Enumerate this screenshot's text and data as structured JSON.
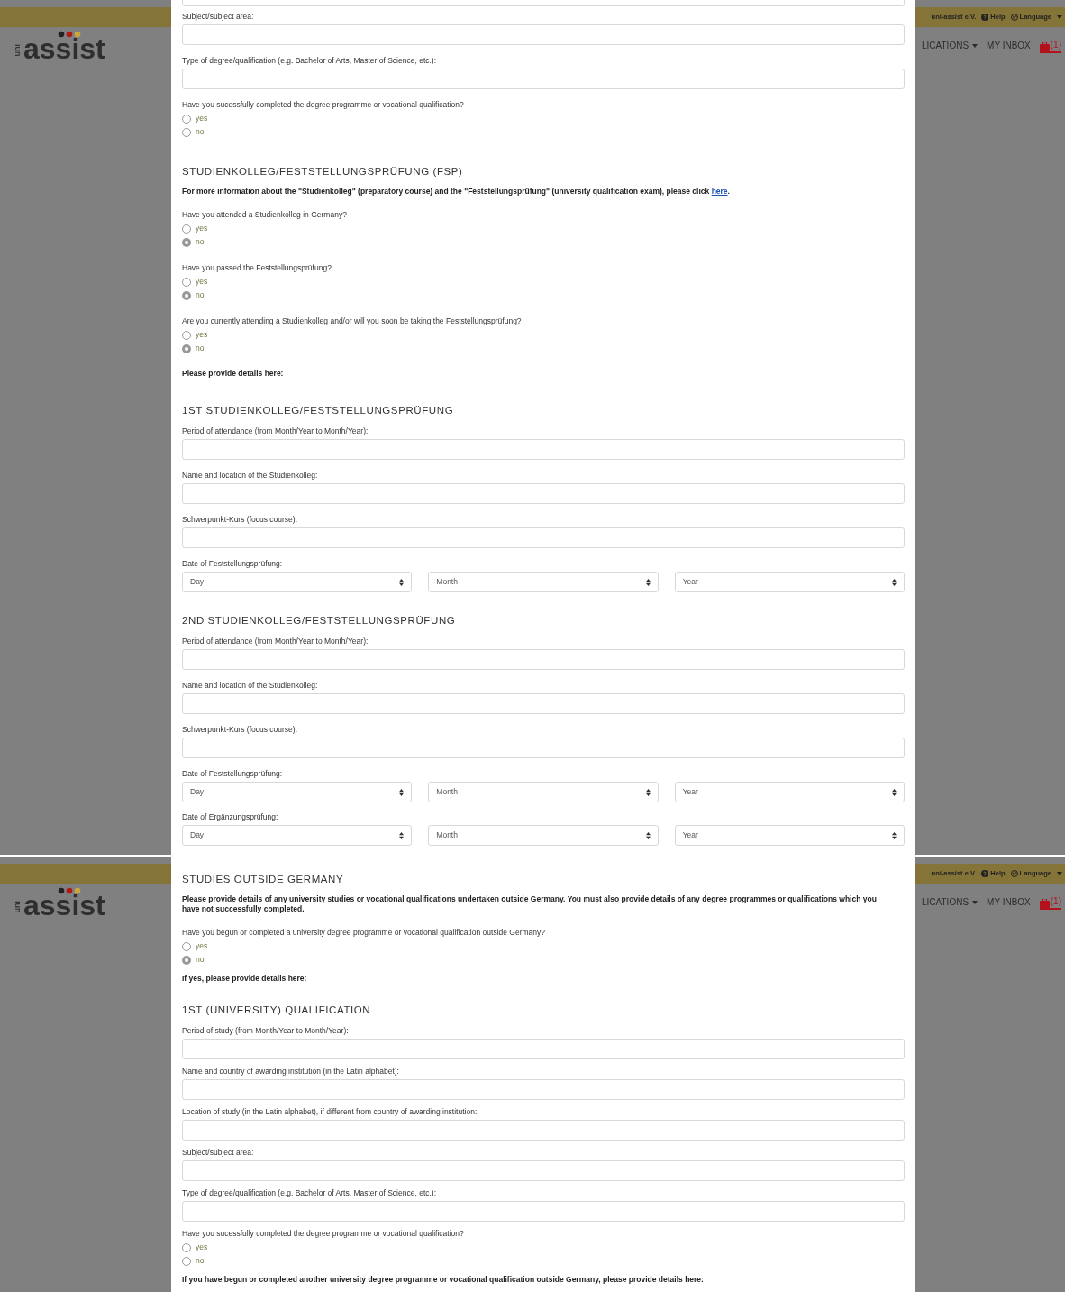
{
  "panels": [
    {
      "logo": {
        "small": "uni",
        "big": "assist"
      },
      "header": {
        "org": "uni-assist e.V.",
        "help": "Help",
        "language": "Language",
        "nav": [
          {
            "label": "LICATIONS",
            "menu": true
          },
          {
            "label": "MY INBOX",
            "menu": false
          }
        ],
        "inbox_count": "(1)"
      },
      "items": [
        {
          "kind": "input"
        },
        {
          "kind": "field",
          "label": "Subject/subject area:"
        },
        {
          "kind": "field",
          "label": "Type of degree/qualification (e.g. Bachelor of Arts, Master of Science, etc.):"
        },
        {
          "kind": "question",
          "label": "Have you sucessfully completed the degree programme or vocational qualification?",
          "options": [
            {
              "label": "yes",
              "selected": false
            },
            {
              "label": "no",
              "selected": false
            }
          ]
        },
        {
          "kind": "heading",
          "text": "STUDIENKOLLEG/FESTSTELLUNGSPRÜFUNG (FSP)"
        },
        {
          "kind": "note",
          "text": "For more information about the \"Studienkolleg\" (preparatory course) and the \"Feststellungsprüfung\" (university qualification exam), please click",
          "link": "here",
          "after": "."
        },
        {
          "kind": "question",
          "label": "Have you attended a Studienkolleg in Germany?",
          "options": [
            {
              "label": "yes",
              "selected": false
            },
            {
              "label": "no",
              "selected": true
            }
          ]
        },
        {
          "kind": "question",
          "label": "Have you passed the Feststellungsprüfung?",
          "options": [
            {
              "label": "yes",
              "selected": false
            },
            {
              "label": "no",
              "selected": true
            }
          ]
        },
        {
          "kind": "question",
          "label": "Are you currently attending a Studienkolleg and/or will you soon be taking the Feststellungsprüfung?",
          "options": [
            {
              "label": "yes",
              "selected": false
            },
            {
              "label": "no",
              "selected": true
            }
          ]
        },
        {
          "kind": "note",
          "text": "Please provide details here:"
        },
        {
          "kind": "heading",
          "text": "1ST STUDIENKOLLEG/FESTSTELLUNGSPRÜFUNG"
        },
        {
          "kind": "field",
          "label": "Period of attendance (from Month/Year to Month/Year):"
        },
        {
          "kind": "field",
          "label": "Name and location of the Studienkolleg:"
        },
        {
          "kind": "field",
          "label": "Schwerpunkt-Kurs (focus course):"
        },
        {
          "kind": "date",
          "label": "Date of Feststellungsprüfung:",
          "selects": [
            "Day",
            "Month",
            "Year"
          ]
        },
        {
          "kind": "heading",
          "text": "2ND STUDIENKOLLEG/FESTSTELLUNGSPRÜFUNG"
        },
        {
          "kind": "field",
          "label": "Period of attendance (from Month/Year to Month/Year):"
        },
        {
          "kind": "field",
          "label": "Name and location of the Studienkolleg:"
        },
        {
          "kind": "field",
          "label": "Schwerpunkt-Kurs (focus course):"
        },
        {
          "kind": "date",
          "label": "Date of Feststellungsprüfung:",
          "selects": [
            "Day",
            "Month",
            "Year"
          ]
        },
        {
          "kind": "date",
          "label": "Date of Ergänzungsprüfung:",
          "selects": [
            "Day",
            "Month",
            "Year"
          ]
        }
      ]
    },
    {
      "logo": {
        "small": "uni",
        "big": "assist"
      },
      "header": {
        "org": "uni-assist e.V.",
        "help": "Help",
        "language": "Language",
        "nav": [
          {
            "label": "LICATIONS",
            "menu": true
          },
          {
            "label": "MY INBOX",
            "menu": false
          }
        ],
        "inbox_count": "(1)"
      },
      "items": [
        {
          "kind": "heading",
          "text": "STUDIES OUTSIDE GERMANY"
        },
        {
          "kind": "note",
          "text": "Please provide details of any university studies or vocational qualifications undertaken outside Germany. You must also provide details of any degree programmes or qualifications which you have not successfully completed."
        },
        {
          "kind": "question",
          "label": "Have you begun or completed a university degree programme or vocational qualification outside Germany?",
          "options": [
            {
              "label": "yes",
              "selected": false
            },
            {
              "label": "no",
              "selected": true
            }
          ]
        },
        {
          "kind": "note",
          "text": "If yes, please provide details here:"
        },
        {
          "kind": "heading",
          "text": "1ST (UNIVERSITY) QUALIFICATION"
        },
        {
          "kind": "field",
          "label": "Period of study (from Month/Year to Month/Year):"
        },
        {
          "kind": "field",
          "label": "Name and country of awarding institution (in the Latin alphabet):"
        },
        {
          "kind": "field",
          "label": "Location of study (in the Latin alphabet), if different from country of awarding institution:"
        },
        {
          "kind": "field",
          "label": "Subject/subject area:"
        },
        {
          "kind": "field",
          "label": "Type of degree/qualification (e.g. Bachelor of Arts, Master of Science, etc.):"
        },
        {
          "kind": "question",
          "label": "Have you sucessfully completed the degree programme or vocational qualification?",
          "options": [
            {
              "label": "yes",
              "selected": false
            },
            {
              "label": "no",
              "selected": false
            }
          ]
        },
        {
          "kind": "note",
          "text": "If you have begun or completed another university degree programme or vocational qualification outside Germany, please provide details here:"
        }
      ]
    }
  ]
}
